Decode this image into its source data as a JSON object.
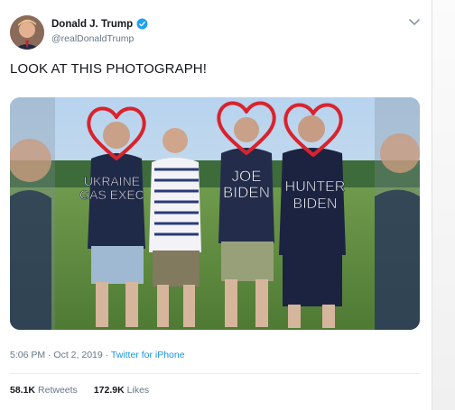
{
  "tweet": {
    "author_name": "Donald J. Trump",
    "author_handle": "@realDonaldTrump",
    "text": "LOOK AT THIS PHOTOGRAPH!",
    "time": "5:06 PM · Oct 2, 2019",
    "separator": " · ",
    "source": "Twitter for iPhone",
    "retweets_count": "58.1K",
    "retweets_label": "Retweets",
    "likes_count": "172.9K",
    "likes_label": "Likes"
  },
  "photo": {
    "label_left_line1": "UKRAINE",
    "label_left_line2": "GAS EXEC",
    "label_mid_line1": "JOE",
    "label_mid_line2": "BIDEN",
    "label_right_line1": "HUNTER",
    "label_right_line2": "BIDEN"
  },
  "colors": {
    "verified": "#1da1f2",
    "link": "#1b95e0",
    "heart": "#d9232d"
  },
  "icons": {
    "verified": "verified-badge-icon",
    "menu": "chevron-down-icon"
  }
}
